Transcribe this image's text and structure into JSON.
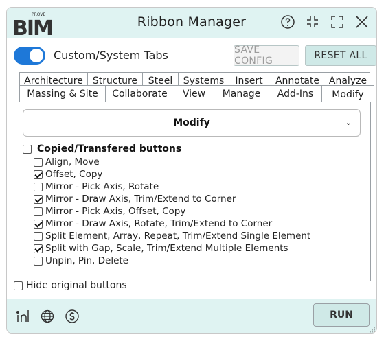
{
  "window": {
    "title": "Ribbon Manager",
    "logo_text": "BIM",
    "logo_small": "PROVE"
  },
  "titlebar_icons": [
    "help-icon",
    "collapse-icon",
    "expand-icon",
    "close-icon"
  ],
  "toggle": {
    "label": "Custom/System Tabs",
    "state": "on"
  },
  "buttons": {
    "save_config": "SAVE CONFIG",
    "reset_all": "RESET ALL",
    "run": "RUN"
  },
  "tabs_row1": [
    "Architecture",
    "Structure",
    "Steel",
    "Systems",
    "Insert",
    "Annotate",
    "Analyze"
  ],
  "tabs_row2": [
    "Massing & Site",
    "Collaborate",
    "View",
    "Manage",
    "Add-Ins",
    "Modify"
  ],
  "active_tab": "Modify",
  "dropdown": {
    "selected": "Modify"
  },
  "group": {
    "label": "Copied/Transfered buttons",
    "checked": false
  },
  "items": [
    {
      "label": "Align, Move",
      "checked": false
    },
    {
      "label": "Offset, Copy",
      "checked": true
    },
    {
      "label": "Mirror - Pick Axis, Rotate",
      "checked": false
    },
    {
      "label": "Mirror - Draw Axis, Trim/Extend to Corner",
      "checked": true
    },
    {
      "label": "Mirror - Pick Axis, Offset, Copy",
      "checked": false
    },
    {
      "label": "Mirror - Draw Axis, Rotate, Trim/Extend to Corner",
      "checked": true
    },
    {
      "label": "Split Element, Array, Repeat, Trim/Extend Single Element",
      "checked": false
    },
    {
      "label": "Split with Gap, Scale, Trim/Extend Multiple Elements",
      "checked": true
    },
    {
      "label": "Unpin, Pin, Delete",
      "checked": false
    }
  ],
  "hide_original": {
    "label": "Hide original buttons",
    "checked": false
  },
  "footer_icons": [
    "linkedin-icon",
    "globe-icon",
    "dollar-icon"
  ],
  "colors": {
    "header_bg": "#dff3f2",
    "accent": "#1e78d8",
    "button_bg": "#cfe9e7"
  }
}
